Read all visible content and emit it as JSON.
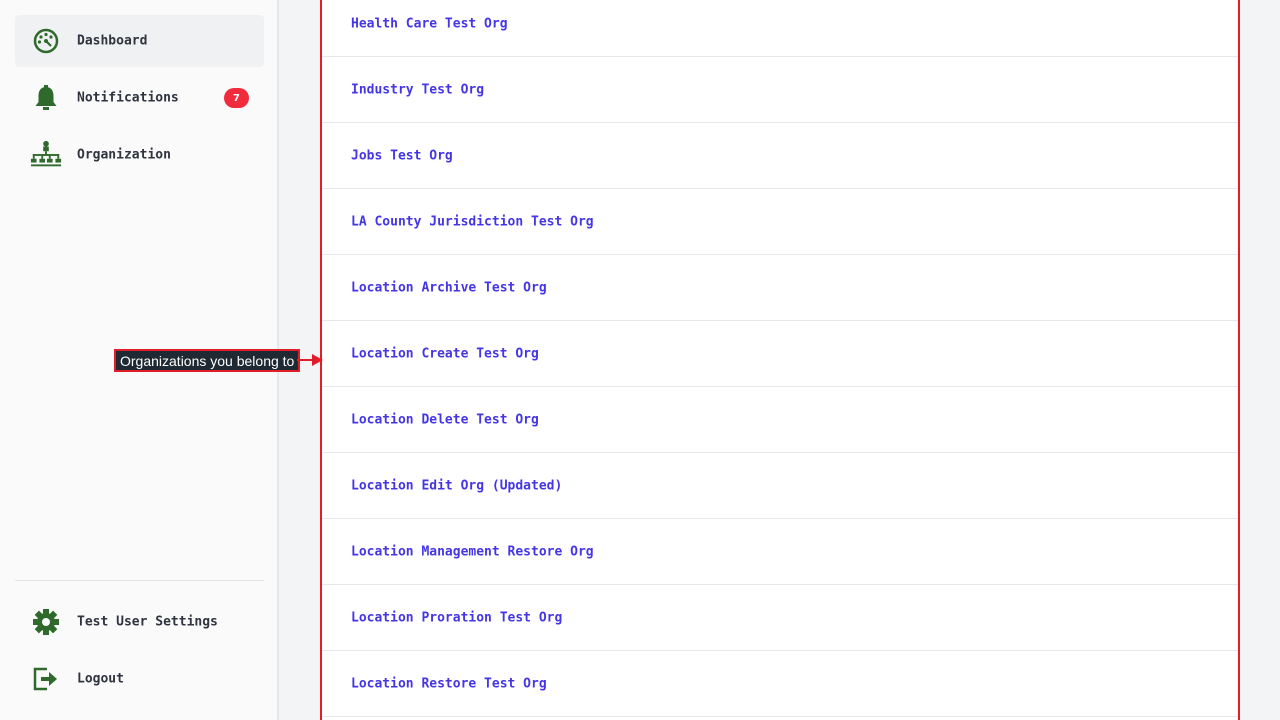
{
  "sidebar": {
    "items": [
      {
        "label": "Dashboard",
        "icon": "dashboard-icon"
      },
      {
        "label": "Notifications",
        "icon": "bell-icon",
        "badge": "7"
      },
      {
        "label": "Organization",
        "icon": "org-chart-icon"
      }
    ],
    "footer": [
      {
        "label": "Test User Settings",
        "icon": "gear-icon"
      },
      {
        "label": "Logout",
        "icon": "logout-icon"
      }
    ]
  },
  "organizations": [
    "Health Care Test Org",
    "Industry Test Org",
    "Jobs Test Org",
    "LA County Jurisdiction Test Org",
    "Location Archive Test Org",
    "Location Create Test Org",
    "Location Delete Test Org",
    "Location Edit Org (Updated)",
    "Location Management Restore Org",
    "Location Proration Test Org",
    "Location Restore Test Org"
  ],
  "annotation": {
    "label": "Organizations you belong to"
  },
  "colors": {
    "icon_green": "#2f6a2c",
    "link_blue": "#4436e6",
    "badge_red": "#ef2b3c",
    "highlight_red": "#e11d2a"
  }
}
